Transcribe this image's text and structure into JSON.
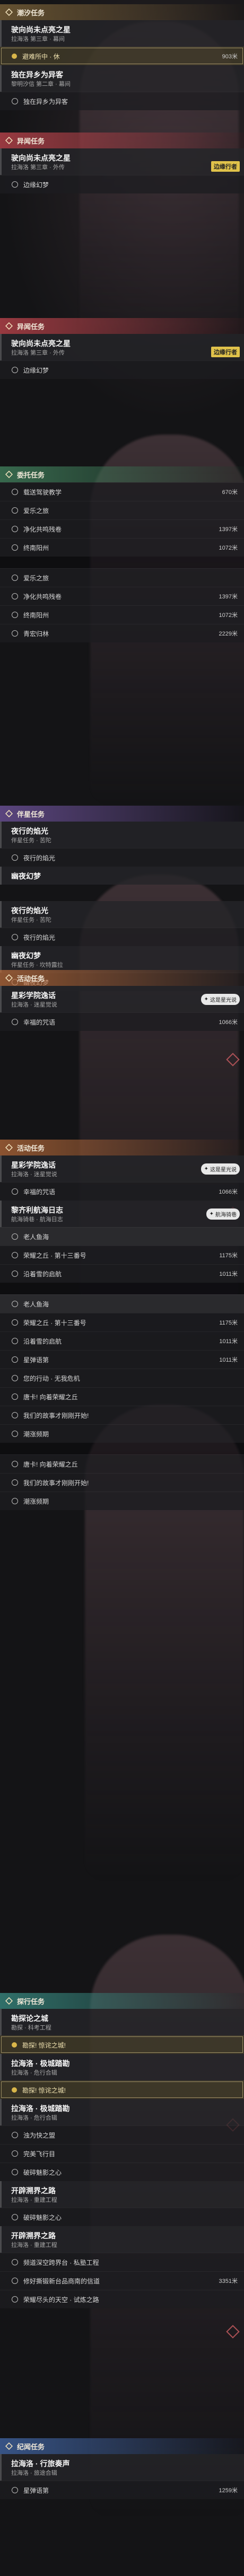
{
  "sections": [
    {
      "id": "s1",
      "color": "gold",
      "header": "潮汐任务",
      "quests": [
        {
          "title": "驶向尚未点亮之星",
          "sub": "拉海洛 第三章 · 幕间",
          "steps": [
            {
              "text": "避难所中 · 休",
              "dist": "903米",
              "state": "done"
            }
          ]
        },
        {
          "title": "独在异乡为异客",
          "sub": "黎明汐信 第二章 · 幕间",
          "steps": [
            {
              "text": "独在异乡为异客",
              "state": "open"
            }
          ]
        }
      ]
    },
    {
      "id": "s2",
      "color": "red",
      "header": "异闻任务",
      "quests": [
        {
          "title": "驶向尚未点亮之星",
          "sub": "拉海洛 第三章 · 外传",
          "tag": "边缘行者",
          "steps": [
            {
              "text": "边缘幻梦",
              "state": "open"
            }
          ]
        }
      ]
    },
    {
      "id": "s3",
      "color": "red",
      "header": "异闻任务",
      "quests": [
        {
          "title": "驶向尚未点亮之星",
          "sub": "拉海洛 第三章 · 外传",
          "tag": "边缘行者",
          "steps": [
            {
              "text": "边缘幻梦",
              "state": "open"
            }
          ]
        }
      ]
    },
    {
      "id": "s4",
      "color": "green",
      "header": "委托任务",
      "quests": [
        {
          "title": "",
          "sub": "",
          "steps": [
            {
              "text": "载送驾驶教学",
              "dist": "670米",
              "state": "open"
            },
            {
              "text": "爱乐之旅",
              "state": "open"
            },
            {
              "text": "净化共鸣残卷",
              "dist": "1397米",
              "state": "open"
            },
            {
              "text": "终南阳州",
              "dist": "1072米",
              "state": "open"
            },
            {
              "text": "",
              "state": "gap"
            },
            {
              "text": "爱乐之旅",
              "state": "open"
            },
            {
              "text": "净化共鸣残卷",
              "dist": "1397米",
              "state": "open"
            },
            {
              "text": "终南阳州",
              "dist": "1072米",
              "state": "open"
            },
            {
              "text": "青宏归林",
              "dist": "2229米",
              "state": "open"
            }
          ]
        }
      ]
    },
    {
      "id": "s5",
      "color": "purple",
      "header": "伴星任务",
      "quests": [
        {
          "title": "夜行的焰光",
          "sub": "伴星任务 · 苦陀",
          "steps": [
            {
              "text": "夜行的焰光",
              "state": "open"
            }
          ]
        },
        {
          "title": "幽夜幻梦",
          "sub": "",
          "steps": []
        }
      ]
    },
    {
      "id": "s5b",
      "color": "purple",
      "header": "",
      "quests": [
        {
          "title": "夜行的焰光",
          "sub": "伴星任务 · 苦陀",
          "steps": [
            {
              "text": "夜行的焰光",
              "state": "open"
            }
          ]
        },
        {
          "title": "幽夜幻梦",
          "sub": "伴星任务 · 坎特露拉",
          "steps": [
            {
              "text": "幽夜幻梦",
              "state": "open"
            }
          ]
        }
      ]
    },
    {
      "id": "s6",
      "color": "orange",
      "header": "活动任务",
      "quests": [
        {
          "title": "星彩学院逸话",
          "sub": "拉海洛 · 迷星觉说",
          "badge": "这是星光说",
          "steps": [
            {
              "text": "幸福的咒语",
              "dist": "1066米",
              "state": "open"
            }
          ]
        }
      ]
    },
    {
      "id": "s7",
      "color": "orange",
      "header": "活动任务",
      "quests": [
        {
          "title": "星彩学院逸话",
          "sub": "拉海洛 · 迷星觉说",
          "badge": "这是星光说",
          "steps": [
            {
              "text": "幸福的咒语",
              "dist": "1066米",
              "state": "open"
            }
          ]
        },
        {
          "title": "黎齐利航海日志",
          "sub": "航海骑巷 · 航海日志",
          "badge": "航海骑巷",
          "steps": [
            {
              "text": "老人鱼海",
              "state": "active"
            },
            {
              "text": "荣耀之丘 · 第十三番号",
              "dist": "1175米",
              "state": "open"
            },
            {
              "text": "沿着雪的启航",
              "dist": "1011米",
              "state": "open"
            },
            {
              "text": "",
              "state": "gap"
            },
            {
              "text": "老人鱼海",
              "state": "active"
            },
            {
              "text": "荣耀之丘 · 第十三番号",
              "dist": "1175米",
              "state": "open"
            },
            {
              "text": "沿着雪的启航",
              "dist": "1011米",
              "state": "open"
            },
            {
              "text": "星弹语第",
              "dist": "1011米",
              "state": "open"
            },
            {
              "text": "您的行动 · 无我危机",
              "state": "open"
            },
            {
              "text": "唐卡! 向着荣耀之丘",
              "state": "open"
            },
            {
              "text": "我们的故事才刚刚开始!",
              "state": "open"
            },
            {
              "text": "潮涨频期",
              "state": "open"
            },
            {
              "text": "",
              "state": "gap"
            },
            {
              "text": "唐卡! 向着荣耀之丘",
              "state": "open"
            },
            {
              "text": "我们的故事才刚刚开始!",
              "state": "open"
            },
            {
              "text": "潮涨频期",
              "state": "open"
            }
          ]
        }
      ]
    },
    {
      "id": "s8",
      "color": "teal",
      "header": "探行任务",
      "quests": [
        {
          "title": "勘探论之城",
          "sub": "勘探 · 科考工程",
          "steps": [
            {
              "text": "勘探! 惊诧之城!",
              "state": "done"
            }
          ]
        },
        {
          "title": "拉海洛 · 极城踏勘",
          "sub": "拉海洛 · 危行合辑",
          "steps": [
            {
              "text": "勘探! 惊诧之城!",
              "state": "done"
            }
          ]
        },
        {
          "title": "拉海洛 · 极城踏勘",
          "sub": "拉海洛 · 危行合辑",
          "steps": [
            {
              "text": "浊为快之盟",
              "state": "open"
            },
            {
              "text": "完美飞行目",
              "state": "open"
            },
            {
              "text": "破碎魅影之心",
              "state": "open"
            }
          ]
        },
        {
          "title": "开辟溯界之路",
          "sub": "拉海洛 · 重建工程",
          "steps": [
            {
              "text": "破碎魅影之心",
              "state": "open"
            }
          ]
        },
        {
          "title": "开辟溯界之路",
          "sub": "拉海洛 · 重建工程",
          "steps": [
            {
              "text": "频道深空跨界台 · 私塾工程",
              "state": "open"
            },
            {
              "text": "修好撕锻新台品商南的信道",
              "dist": "3351米",
              "state": "open"
            },
            {
              "text": "荣耀尽头的天空 · 试炼之路",
              "state": "open"
            }
          ]
        }
      ]
    },
    {
      "id": "s9",
      "color": "blue",
      "header": "纪闻任务",
      "quests": [
        {
          "title": "拉海洛 · 行旅奏声",
          "sub": "拉海洛 · 旅途合辑",
          "steps": [
            {
              "text": "星弹语第",
              "dist": "1259米",
              "state": "open"
            }
          ]
        }
      ]
    }
  ]
}
